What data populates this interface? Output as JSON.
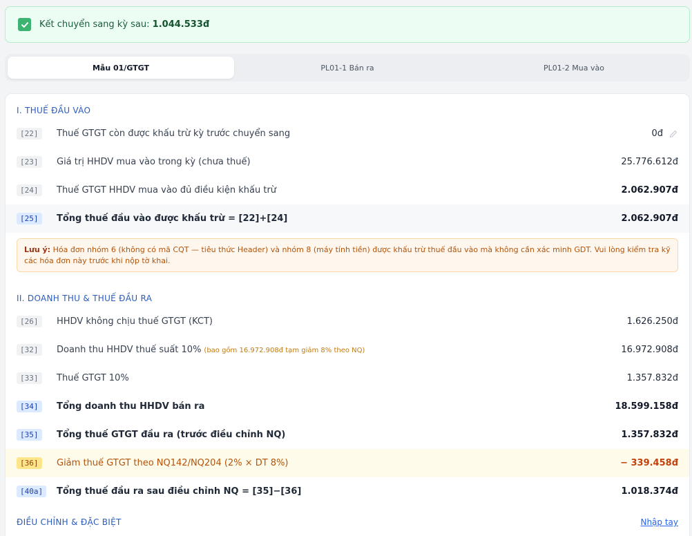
{
  "banner": {
    "label": "Kết chuyển sang kỳ sau:",
    "amount": "1.044.533đ"
  },
  "tabs": [
    {
      "label": "Mẫu 01/GTGT",
      "active": true
    },
    {
      "label": "PL01-1 Bán ra",
      "active": false
    },
    {
      "label": "PL01-2 Mua vào",
      "active": false
    }
  ],
  "section1": {
    "title": "I. THUẾ ĐẦU VÀO",
    "rows": [
      {
        "code": "[22]",
        "label": "Thuế GTGT còn được khấu trừ kỳ trước chuyển sang",
        "value": "0đ"
      },
      {
        "code": "[23]",
        "label": "Giá trị HHDV mua vào trong kỳ (chưa thuế)",
        "value": "25.776.612đ"
      },
      {
        "code": "[24]",
        "label": "Thuế GTGT HHDV mua vào đủ điều kiện khấu trừ",
        "value": "2.062.907đ"
      },
      {
        "code": "[25]",
        "label": "Tổng thuế đầu vào được khấu trừ = [22]+[24]",
        "value": "2.062.907đ"
      }
    ]
  },
  "alert": {
    "prefix": "Lưu ý:",
    "text": "Hóa đơn nhóm 6 (không có mã CQT — tiêu thức Header) và nhóm 8 (máy tính tiền) được khấu trừ thuế đầu vào mà không cần xác minh GDT. Vui lòng kiểm tra kỹ các hóa đơn này trước khi nộp tờ khai."
  },
  "section2": {
    "title": "II. DOANH THU & THUẾ ĐẦU RA",
    "rows": [
      {
        "code": "[26]",
        "label": "HHDV không chịu thuế GTGT (KCT)",
        "value": "1.626.250đ"
      },
      {
        "code": "[32]",
        "label": "Doanh thu HHDV thuế suất 10%",
        "note": "(bao gồm 16.972.908đ tạm giảm 8% theo NQ)",
        "value": "16.972.908đ"
      },
      {
        "code": "[33]",
        "label": "Thuế GTGT 10%",
        "value": "1.357.832đ"
      },
      {
        "code": "[34]",
        "label": "Tổng doanh thu HHDV bán ra",
        "value": "18.599.158đ"
      },
      {
        "code": "[35]",
        "label": "Tổng thuế GTGT đầu ra (trước điều chỉnh NQ)",
        "value": "1.357.832đ"
      },
      {
        "code": "[36]",
        "label": "Giảm thuế GTGT theo NQ142/NQ204 (2% × DT 8%)",
        "value": "− 339.458đ"
      },
      {
        "code": "[40a]",
        "label": "Tổng thuế đầu ra sau điều chỉnh NQ = [35]−[36]",
        "value": "1.018.374đ"
      }
    ]
  },
  "section3": {
    "title": "ĐIỀU CHỈNH & ĐẶC BIỆT",
    "manual_link": "Nhập tay"
  },
  "icons": {
    "check": "check-icon",
    "edit": "pencil-icon"
  },
  "colors": {
    "accent": "#2a5bbd",
    "success": "#3cb371",
    "warning": "#b45309"
  }
}
